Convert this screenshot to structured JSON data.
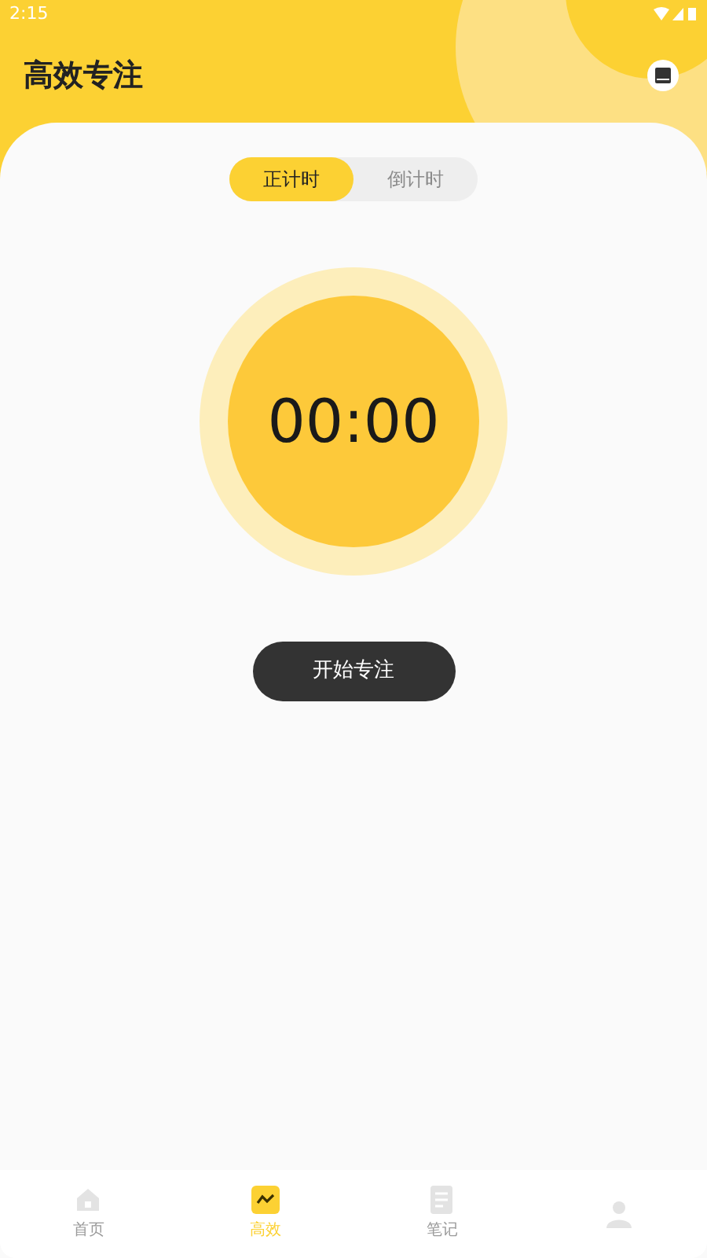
{
  "status_bar": {
    "time": "2:15"
  },
  "header": {
    "title": "高效专注"
  },
  "mode_tabs": [
    {
      "label": "正计时",
      "selected": true
    },
    {
      "label": "倒计时",
      "selected": false
    }
  ],
  "timer": {
    "display": "00:00"
  },
  "start_button": {
    "label": "开始专注"
  },
  "bottom_nav": [
    {
      "kind": "home",
      "label": "首页",
      "selected": false
    },
    {
      "kind": "focus",
      "label": "高效",
      "selected": true
    },
    {
      "kind": "notes",
      "label": "笔记",
      "selected": false
    },
    {
      "kind": "profile",
      "selected": false
    }
  ]
}
